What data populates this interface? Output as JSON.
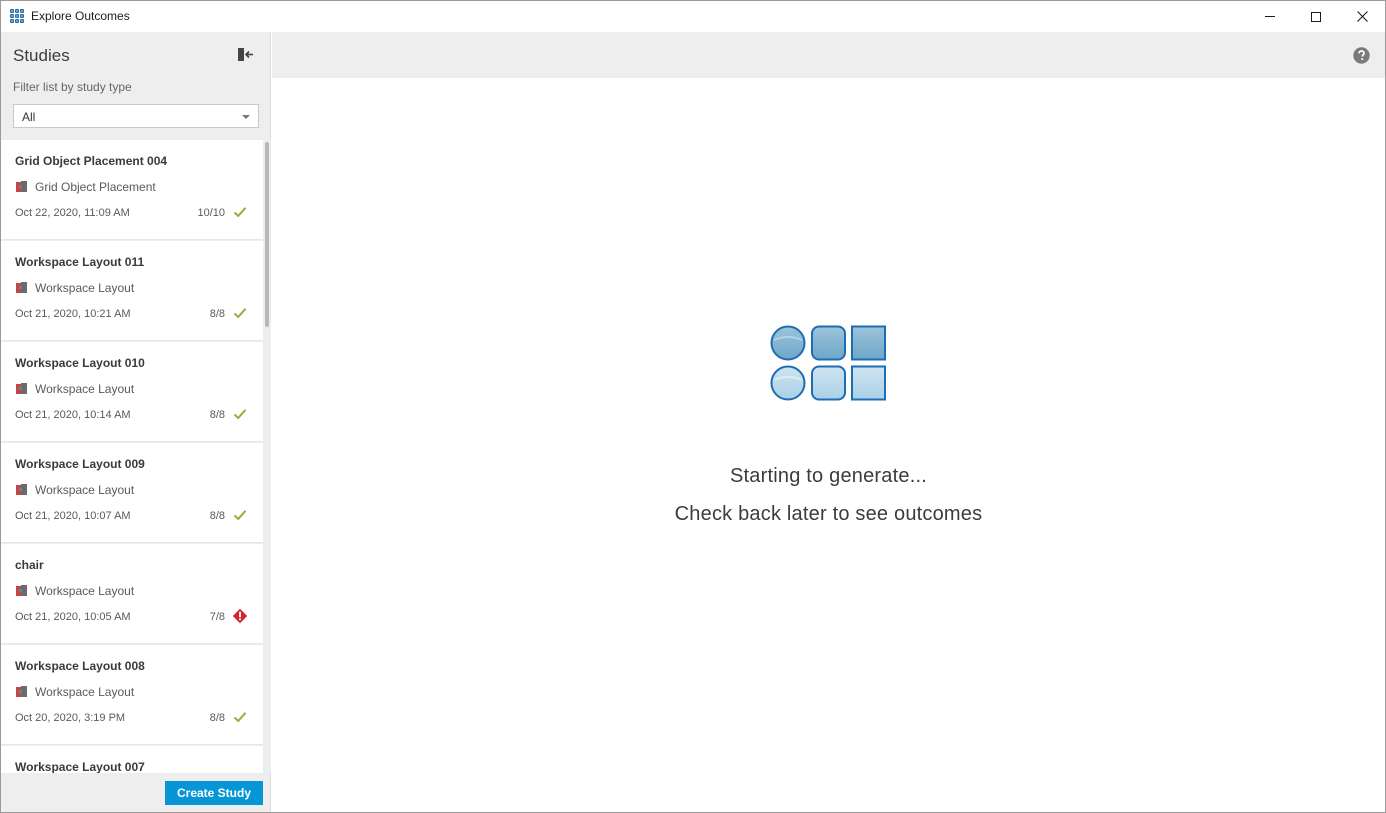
{
  "window": {
    "title": "Explore Outcomes"
  },
  "sidebar": {
    "title": "Studies",
    "filter_label": "Filter list by study type",
    "filter_value": "All",
    "create_label": "Create Study",
    "studies": [
      {
        "name": "Grid Object Placement 004",
        "type": "Grid Object Placement",
        "date": "Oct 22, 2020, 11:09 AM",
        "count": "10/10",
        "status": "success"
      },
      {
        "name": "Workspace Layout 011",
        "type": "Workspace Layout",
        "date": "Oct 21, 2020, 10:21 AM",
        "count": "8/8",
        "status": "success"
      },
      {
        "name": "Workspace Layout 010",
        "type": "Workspace Layout",
        "date": "Oct 21, 2020, 10:14 AM",
        "count": "8/8",
        "status": "success"
      },
      {
        "name": "Workspace Layout 009",
        "type": "Workspace Layout",
        "date": "Oct 21, 2020, 10:07 AM",
        "count": "8/8",
        "status": "success"
      },
      {
        "name": "chair",
        "type": "Workspace Layout",
        "date": "Oct 21, 2020, 10:05 AM",
        "count": "7/8",
        "status": "error"
      },
      {
        "name": "Workspace Layout 008",
        "type": "Workspace Layout",
        "date": "Oct 20, 2020, 3:19 PM",
        "count": "8/8",
        "status": "success"
      },
      {
        "name": "Workspace Layout 007"
      }
    ]
  },
  "main": {
    "status_title": "Starting to generate...",
    "status_subtitle": "Check back later to see outcomes"
  },
  "colors": {
    "accent": "#0696d7",
    "success": "#87b340",
    "error": "#d0262f"
  }
}
